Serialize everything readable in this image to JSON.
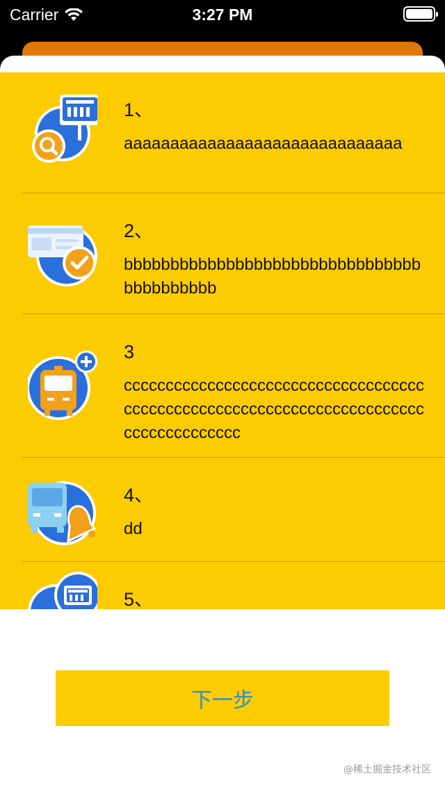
{
  "status_bar": {
    "carrier": "Carrier",
    "time": "3:27 PM"
  },
  "list": {
    "items": [
      {
        "title": "1、",
        "description": "aaaaaaaaaaaaaaaaaaaaaaaaaaaaaa",
        "icon": "search-board-icon"
      },
      {
        "title": "2、",
        "description": "bbbbbbbbbbbbbbbbbbbbbbbbbbbbbbbbbbbbbbbbbb",
        "icon": "card-check-icon"
      },
      {
        "title": "3",
        "description": "cccccccccccccccccccccccccccccccccccccccccccccccccccccccccccccccccccccccccccccccccccccc",
        "icon": "bus-add-icon"
      },
      {
        "title": "4、",
        "description": "dd",
        "icon": "bus-bell-icon"
      },
      {
        "title": "5、",
        "description": "",
        "icon": "search-board-icon"
      }
    ]
  },
  "actions": {
    "next_label": "下一步"
  },
  "watermark": "@稀土掘金技术社区",
  "colors": {
    "list_background": "#fccb00",
    "accent_orange": "#e07808",
    "icon_blue": "#2a6fdc",
    "button_text": "#2a8fd4"
  }
}
